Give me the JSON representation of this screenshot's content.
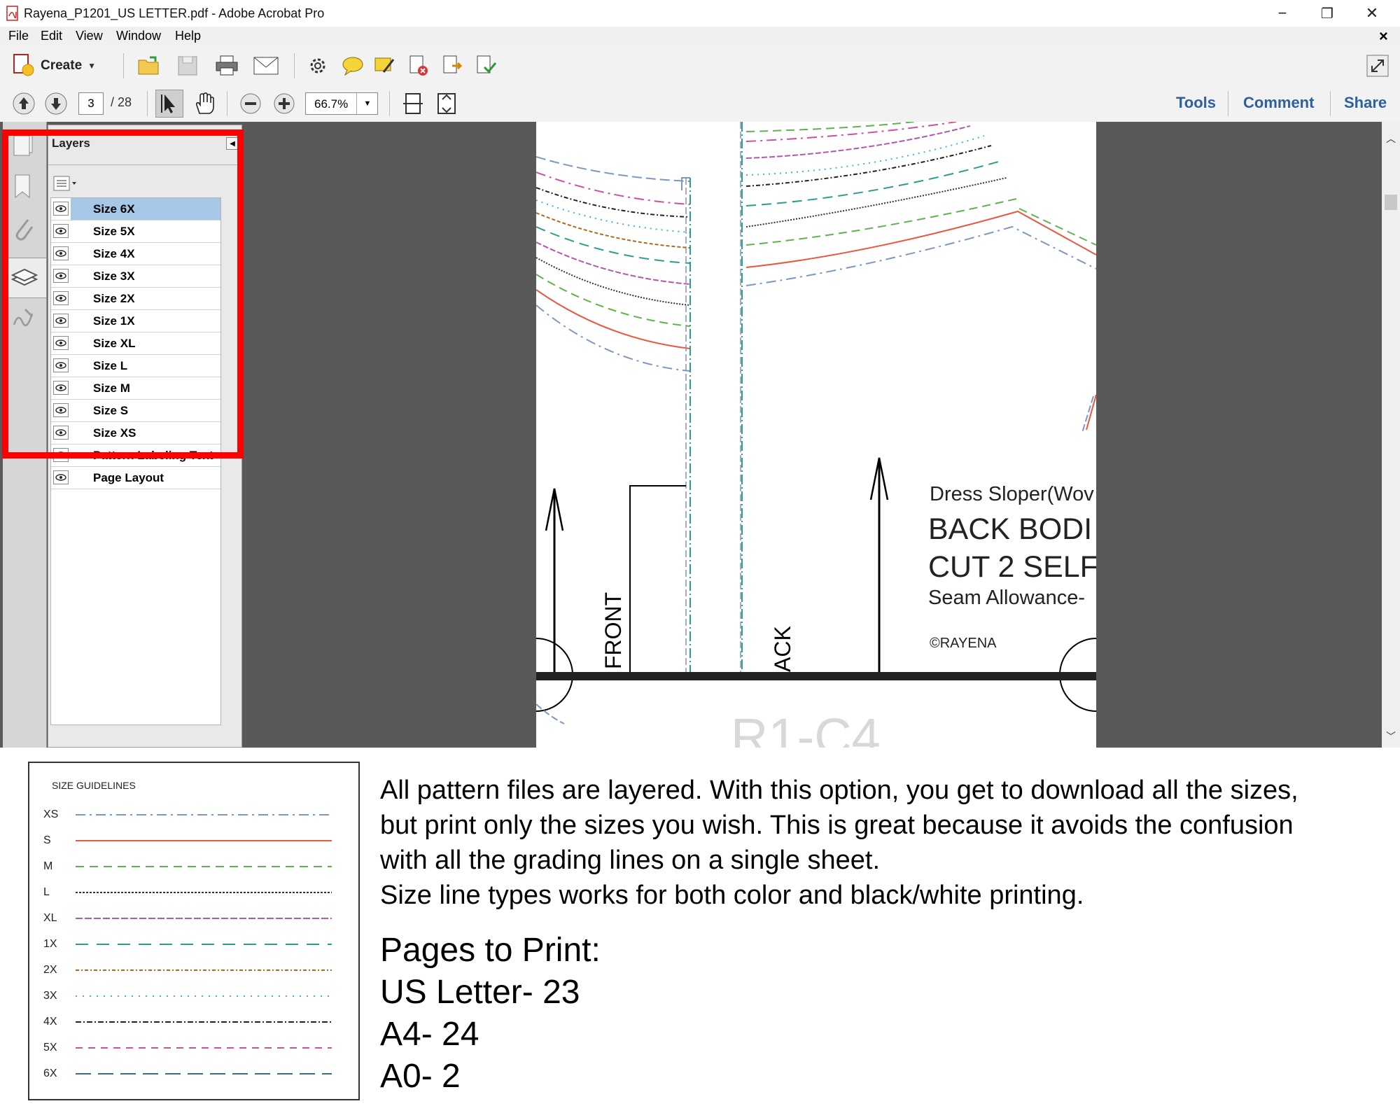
{
  "window": {
    "title": "Rayena_P1201_US LETTER.pdf - Adobe Acrobat Pro",
    "controls": [
      "−",
      "❐",
      "✕"
    ],
    "doc_close": "×"
  },
  "menu": [
    "File",
    "Edit",
    "View",
    "Window",
    "Help"
  ],
  "toolbar": {
    "create_label": "Create",
    "page_current": "3",
    "page_total": "/ 28",
    "zoom": "66.7%",
    "right_links": [
      "Tools",
      "Comment",
      "Share"
    ]
  },
  "layers": {
    "title": "Layers",
    "items": [
      "Size 6X",
      "Size 5X",
      "Size 4X",
      "Size 3X",
      "Size 2X",
      "Size 1X",
      "Size XL",
      "Size L",
      "Size M",
      "Size S",
      "Size XS",
      "Pattern Labeling Text",
      "Page Layout"
    ],
    "selected_index": 0
  },
  "pdf": {
    "text_front": "FRONT",
    "text_back": "ACK",
    "label_line1": "Dress Sloper(Wov",
    "label_line2": "BACK BODI",
    "label_line3": "CUT 2 SELF",
    "label_line4": "Seam Allowance-",
    "copyright": "©RAYENA",
    "grid_code": "R1-C4"
  },
  "legend": {
    "title": "SIZE GUIDELINES",
    "sizes": [
      "XS",
      "S",
      "M",
      "L",
      "XL",
      "1X",
      "2X",
      "3X",
      "4X",
      "5X",
      "6X"
    ],
    "colors": [
      "#7f96c2",
      "#e8583f",
      "#5bb548",
      "#333333",
      "#b455b1",
      "#2a9d8f",
      "#b5651d",
      "#43aee0",
      "#222222",
      "#cc4fa3",
      "#3a6c8f"
    ]
  },
  "description": {
    "line1": "All pattern files are layered. With this option, you get to download all the sizes,",
    "line2": "but print only the sizes you wish. This is great because it avoids the confusion",
    "line3": "with all the grading lines on a single sheet.",
    "line4": "Size line types works for both color and black/white printing."
  },
  "pages_to_print": {
    "heading": "Pages to Print:",
    "items": [
      "US Letter- 23",
      "A4- 24",
      "A0- 2"
    ]
  }
}
